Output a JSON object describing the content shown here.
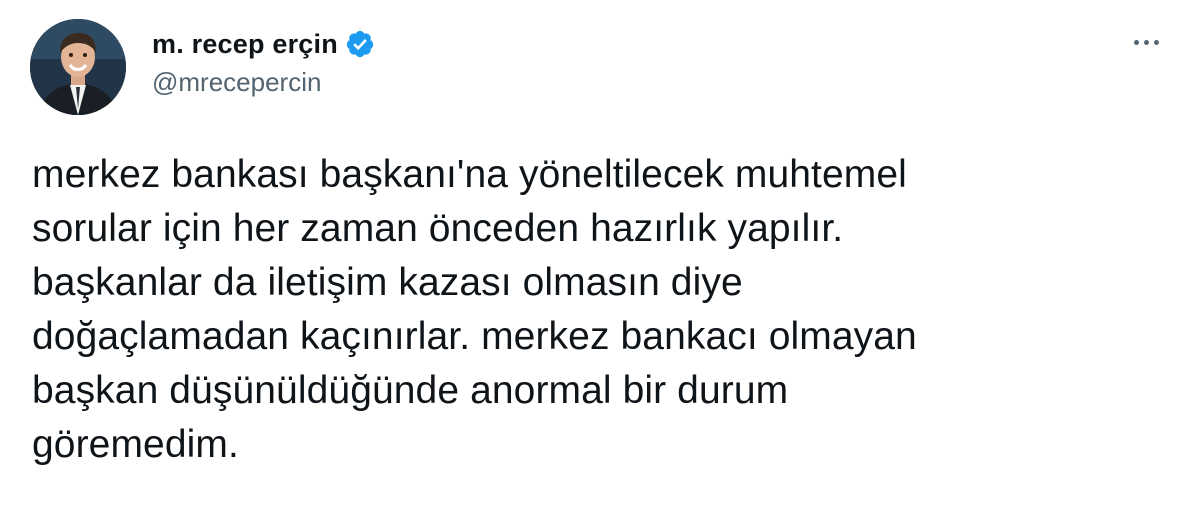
{
  "author": {
    "display_name": "m. recep erçin",
    "handle": "@mrecepercin",
    "verified": true,
    "avatar_icon": "avatar-photo"
  },
  "menu": {
    "icon": "more-options-icon"
  },
  "tweet": {
    "text": "merkez bankası başkanı'na yöneltilecek muhtemel\nsorular için her zaman önceden hazırlık yapılır.\nbaşkanlar da iletişim kazası olmasın diye\ndoğaçlamadan kaçınırlar. merkez bankacı olmayan\nbaşkan düşünüldüğünde anormal bir durum\ngöremedim."
  },
  "colors": {
    "text": "#0f1419",
    "secondary": "#536471",
    "verified": "#1d9bf0"
  }
}
